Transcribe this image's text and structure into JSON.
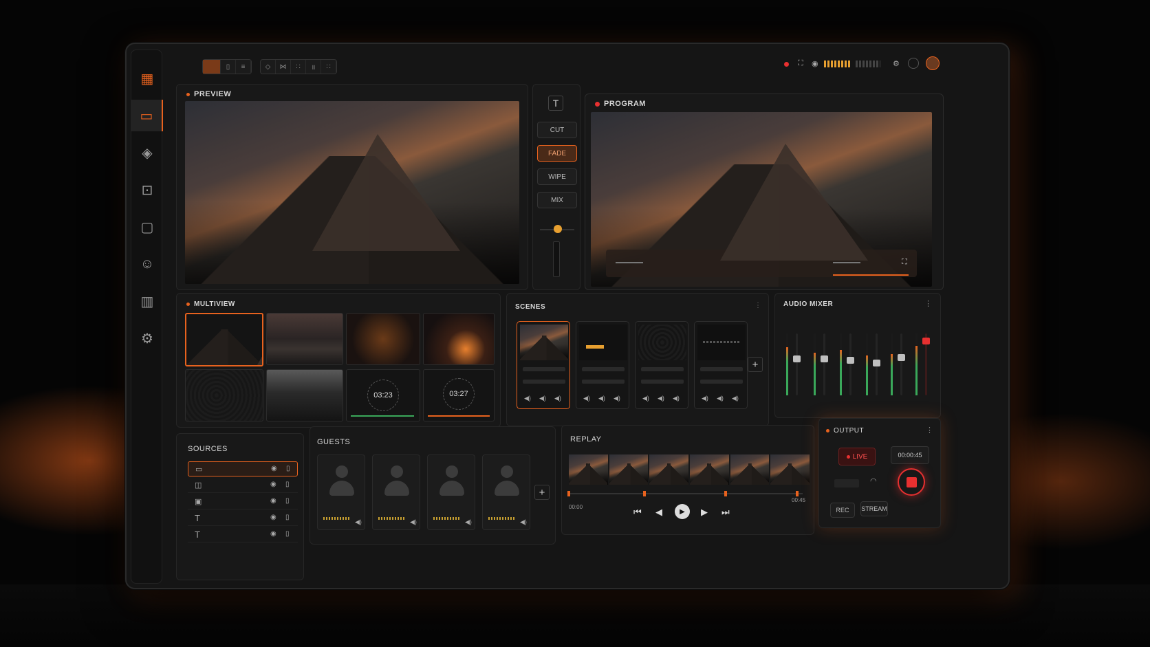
{
  "preview": {
    "title": "PREVIEW"
  },
  "program": {
    "title": "PROGRAM"
  },
  "transitions": {
    "text_tool": "T",
    "buttons": [
      "CUT",
      "FADE",
      "WIPE",
      "MIX"
    ],
    "active": "FADE"
  },
  "multiview": {
    "title": "MULTIVIEW",
    "timers": [
      "03:23",
      "03:27"
    ]
  },
  "scenes": {
    "title": "SCENES",
    "add": "+"
  },
  "audio_mixer": {
    "title": "AUDIO MIXER",
    "menu": "⋮"
  },
  "sources": {
    "title": "SOURCES",
    "items": [
      {
        "type": "display-icon",
        "glyph": "▭"
      },
      {
        "type": "camera-icon",
        "glyph": "◫"
      },
      {
        "type": "image-icon",
        "glyph": "▣"
      },
      {
        "type": "text-icon",
        "glyph": "T"
      },
      {
        "type": "text-icon",
        "glyph": "T"
      }
    ]
  },
  "guests": {
    "title": "GUESTS",
    "add": "+"
  },
  "replay": {
    "title": "REPLAY",
    "start": "00:00",
    "end": "00:45"
  },
  "output": {
    "title": "OUTPUT",
    "live_label": "LIVE",
    "timecode": "00:00:45",
    "rec_label": "REC",
    "stream_label": "STREAM"
  },
  "colors": {
    "accent": "#e8621e",
    "live": "#e83030"
  }
}
